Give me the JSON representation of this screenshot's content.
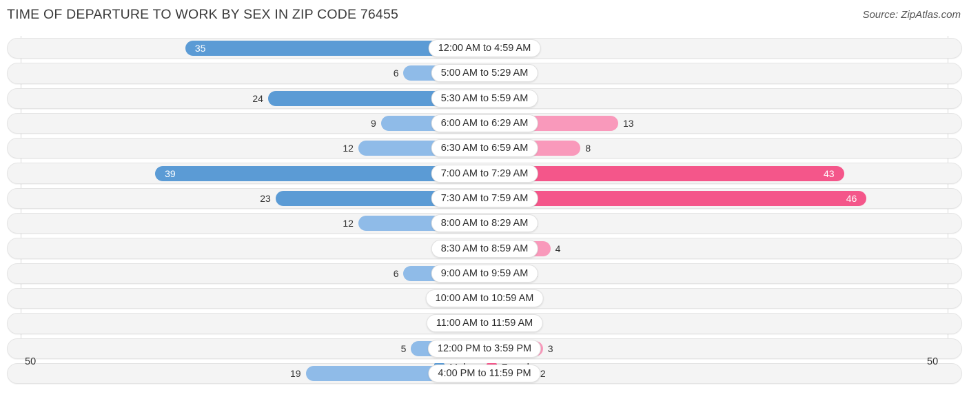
{
  "header": {
    "title": "TIME OF DEPARTURE TO WORK BY SEX IN ZIP CODE 76455",
    "source": "Source: ZipAtlas.com"
  },
  "axis": {
    "left_end_label": "50",
    "right_end_label": "50"
  },
  "legend": {
    "items": [
      {
        "label": "Male",
        "color": "#5b9bd5"
      },
      {
        "label": "Female",
        "color": "#f4568a"
      }
    ]
  },
  "colors": {
    "male_dark": "#5b9bd5",
    "male_light": "#8fbbe8",
    "female_dark": "#f4568a",
    "female_light": "#f999bb",
    "track": "#f4f4f4",
    "gridline": "#d8d8d8"
  },
  "chart_data": {
    "type": "bar",
    "subtype": "diverging-bidirectional",
    "title": "TIME OF DEPARTURE TO WORK BY SEX IN ZIP CODE 76455",
    "xlabel": "",
    "ylabel": "",
    "xlim": [
      50,
      50
    ],
    "grid": true,
    "legend_position": "bottom-center",
    "categories": [
      "12:00 AM to 4:59 AM",
      "5:00 AM to 5:29 AM",
      "5:30 AM to 5:59 AM",
      "6:00 AM to 6:29 AM",
      "6:30 AM to 6:59 AM",
      "7:00 AM to 7:29 AM",
      "7:30 AM to 7:59 AM",
      "8:00 AM to 8:29 AM",
      "8:30 AM to 8:59 AM",
      "9:00 AM to 9:59 AM",
      "10:00 AM to 10:59 AM",
      "11:00 AM to 11:59 AM",
      "12:00 PM to 3:59 PM",
      "4:00 PM to 11:59 PM"
    ],
    "series": [
      {
        "name": "Male",
        "values": [
          35,
          6,
          24,
          9,
          12,
          39,
          23,
          12,
          0,
          6,
          1,
          0,
          5,
          19
        ]
      },
      {
        "name": "Female",
        "values": [
          0,
          0,
          0,
          13,
          8,
          43,
          46,
          1,
          4,
          1,
          0,
          0,
          3,
          2
        ]
      }
    ]
  },
  "rows": [
    {
      "label": "12:00 AM to 4:59 AM",
      "male": 35,
      "male_text": "35",
      "female": 0,
      "female_text": "0"
    },
    {
      "label": "5:00 AM to 5:29 AM",
      "male": 6,
      "male_text": "6",
      "female": 0,
      "female_text": "0"
    },
    {
      "label": "5:30 AM to 5:59 AM",
      "male": 24,
      "male_text": "24",
      "female": 0,
      "female_text": "0"
    },
    {
      "label": "6:00 AM to 6:29 AM",
      "male": 9,
      "male_text": "9",
      "female": 13,
      "female_text": "13"
    },
    {
      "label": "6:30 AM to 6:59 AM",
      "male": 12,
      "male_text": "12",
      "female": 8,
      "female_text": "8"
    },
    {
      "label": "7:00 AM to 7:29 AM",
      "male": 39,
      "male_text": "39",
      "female": 43,
      "female_text": "43"
    },
    {
      "label": "7:30 AM to 7:59 AM",
      "male": 23,
      "male_text": "23",
      "female": 46,
      "female_text": "46"
    },
    {
      "label": "8:00 AM to 8:29 AM",
      "male": 12,
      "male_text": "12",
      "female": 1,
      "female_text": "1"
    },
    {
      "label": "8:30 AM to 8:59 AM",
      "male": 0,
      "male_text": "0",
      "female": 4,
      "female_text": "4"
    },
    {
      "label": "9:00 AM to 9:59 AM",
      "male": 6,
      "male_text": "6",
      "female": 1,
      "female_text": "1"
    },
    {
      "label": "10:00 AM to 10:59 AM",
      "male": 1,
      "male_text": "1",
      "female": 0,
      "female_text": "0"
    },
    {
      "label": "11:00 AM to 11:59 AM",
      "male": 0,
      "male_text": "0",
      "female": 0,
      "female_text": "0"
    },
    {
      "label": "12:00 PM to 3:59 PM",
      "male": 5,
      "male_text": "5",
      "female": 3,
      "female_text": "3"
    },
    {
      "label": "4:00 PM to 11:59 PM",
      "male": 19,
      "male_text": "19",
      "female": 2,
      "female_text": "2"
    }
  ]
}
